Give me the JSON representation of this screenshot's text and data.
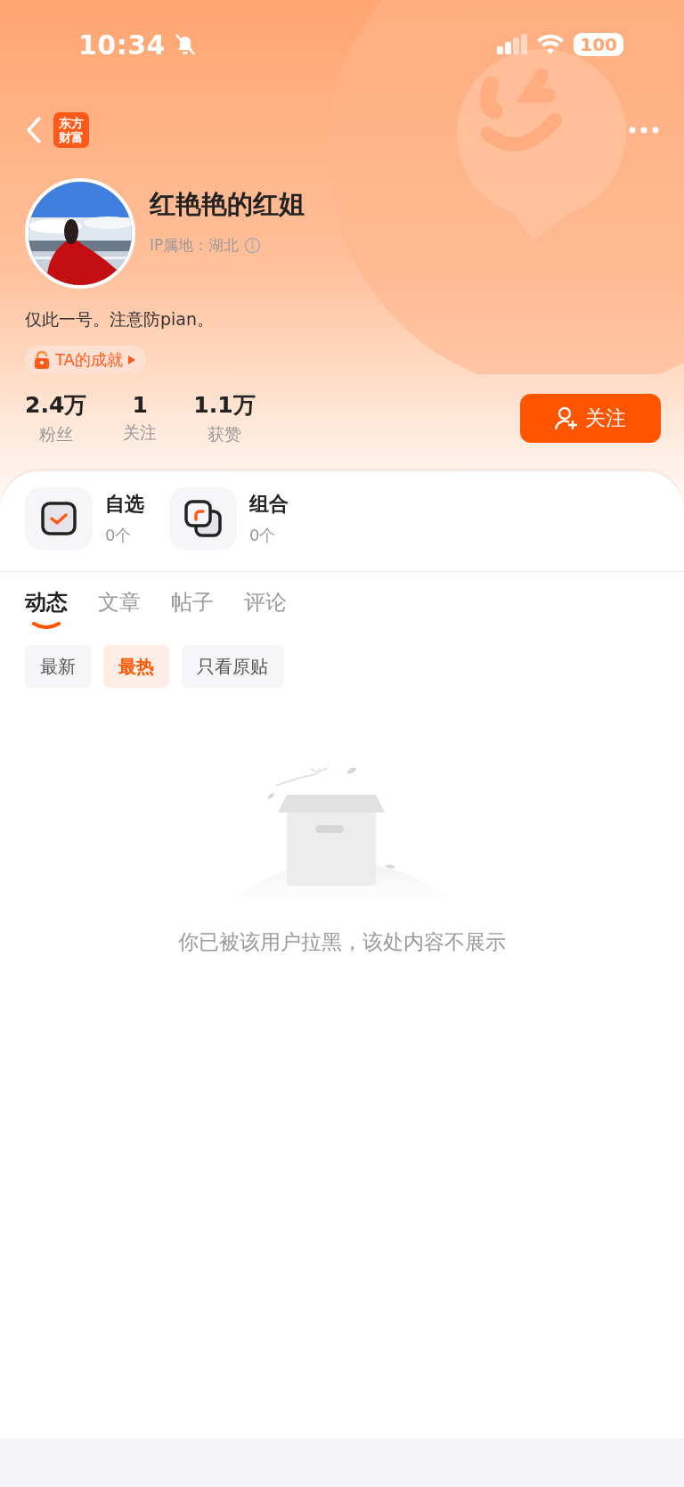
{
  "status_bar": {
    "time": "10:34",
    "battery": "100"
  },
  "nav": {
    "logo_lines": [
      "东方",
      "财富"
    ]
  },
  "profile": {
    "name": "红艳艳的红姐",
    "ip_location": "IP属地：湖北",
    "bio": "仅此一号。注意防pian。",
    "achievement": "TA的成就",
    "stats": [
      {
        "value": "2.4万",
        "label": "粉丝"
      },
      {
        "value": "1",
        "label": "关注"
      },
      {
        "value": "1.1万",
        "label": "获赞"
      }
    ],
    "follow_button": "关注"
  },
  "shortcuts": [
    {
      "kind": "watchlist",
      "title": "自选",
      "count": "0个"
    },
    {
      "kind": "portfolio",
      "title": "组合",
      "count": "0个"
    }
  ],
  "tabs": [
    {
      "label": "动态",
      "selected": true
    },
    {
      "label": "文章",
      "selected": false
    },
    {
      "label": "帖子",
      "selected": false
    },
    {
      "label": "评论",
      "selected": false
    }
  ],
  "filters": [
    {
      "label": "最新",
      "selected": false
    },
    {
      "label": "最热",
      "selected": true
    },
    {
      "label": "只看原贴",
      "selected": false
    }
  ],
  "empty_message": "你已被该用户拉黑，该处内容不展示"
}
